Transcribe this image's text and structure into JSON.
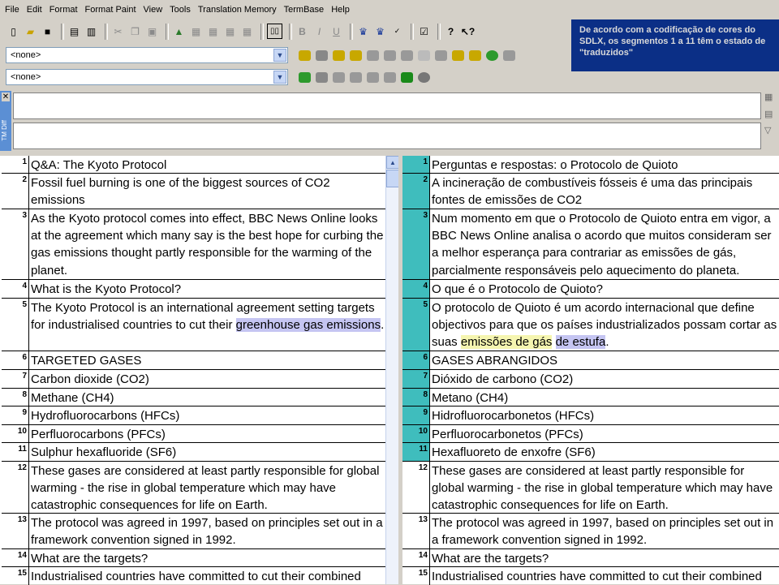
{
  "menu": [
    "File",
    "Edit",
    "Format",
    "Format Paint",
    "View",
    "Tools",
    "Translation Memory",
    "TermBase",
    "Help"
  ],
  "note": "De acordo com a codificação de cores do SDLX, os segmentos 1 a 11 têm o estado de \"traduzidos\"",
  "combo1": "<none>",
  "combo2": "<none>",
  "tm_diff_label": "TM Diff",
  "colors": {
    "translated": "#3fbdbd",
    "highlight_blue": "#c5c5f2",
    "highlight_yellow": "#f5f5b0",
    "note_bg": "#0b2f86"
  },
  "segments": [
    {
      "n": "1",
      "src": "Q&A: The Kyoto Protocol",
      "tgt": "Perguntas e respostas: o Protocolo de Quioto",
      "translated": true
    },
    {
      "n": "2",
      "src": "Fossil fuel burning is one of the biggest sources of CO2 emissions",
      "tgt": "A incineração de combustíveis fósseis é uma das principais fontes de emissões de CO2",
      "translated": true
    },
    {
      "n": "3",
      "src": "As the Kyoto protocol comes into effect, BBC News Online looks at the agreement which many say is the best hope for curbing the gas emissions thought partly responsible for the warming of the planet.",
      "tgt": "Num momento em que o Protocolo de Quioto entra em vigor, a BBC News Online analisa o acordo que muitos consideram ser a melhor esperança para contrariar as emissões de gás, parcialmente responsáveis pelo aquecimento do planeta.",
      "translated": true
    },
    {
      "n": "4",
      "src": "What is the Kyoto Protocol?",
      "tgt": "O que é o Protocolo de Quioto?",
      "translated": true
    },
    {
      "n": "5",
      "src_pre": "The Kyoto Protocol is an international agreement setting targets for industrialised countries to cut their ",
      "src_hl": "greenhouse gas emissions",
      "src_post": ".",
      "tgt_pre": "O protocolo de Quioto é um acordo internacional que define objectivos para que os países industrializados possam cortar as suas ",
      "tgt_hl1": "emissões de gás",
      "tgt_hl2": "de estufa",
      "tgt_post": ".",
      "translated": true
    },
    {
      "n": "6",
      "src": "TARGETED GASES",
      "tgt": "GASES ABRANGIDOS",
      "translated": true
    },
    {
      "n": "7",
      "src": "Carbon dioxide (CO2)",
      "tgt": "Dióxido de carbono (CO2)",
      "translated": true
    },
    {
      "n": "8",
      "src": "Methane (CH4)",
      "tgt": "Metano (CH4)",
      "translated": true
    },
    {
      "n": "9",
      "src": "Hydrofluorocarbons (HFCs)",
      "tgt": "Hidrofluorocarbonetos (HFCs)",
      "translated": true
    },
    {
      "n": "10",
      "src": "Perfluorocarbons (PFCs)",
      "tgt": "Perfluorocarbonetos (PFCs)",
      "translated": true
    },
    {
      "n": "11",
      "src": "Sulphur hexafluoride (SF6)",
      "tgt": "Hexafluoreto de enxofre (SF6)",
      "translated": true
    },
    {
      "n": "12",
      "src": "These gases are considered at least partly responsible for global warming - the rise in global temperature which may have catastrophic consequences for life on Earth.",
      "tgt": "These gases are considered at least partly responsible for global warming - the rise in global temperature which may have catastrophic consequences for life on Earth.",
      "translated": false
    },
    {
      "n": "13",
      "src": "The protocol was agreed in 1997, based on principles set out in a framework convention signed in 1992.",
      "tgt": "The protocol was agreed in 1997, based on principles set out in a framework convention signed in 1992.",
      "translated": false
    },
    {
      "n": "14",
      "src": "What are the targets?",
      "tgt": "What are the targets?",
      "translated": false
    },
    {
      "n": "15",
      "src": "Industrialised countries have committed to cut their combined",
      "tgt": "Industrialised countries have committed to cut their combined",
      "translated": false
    }
  ]
}
